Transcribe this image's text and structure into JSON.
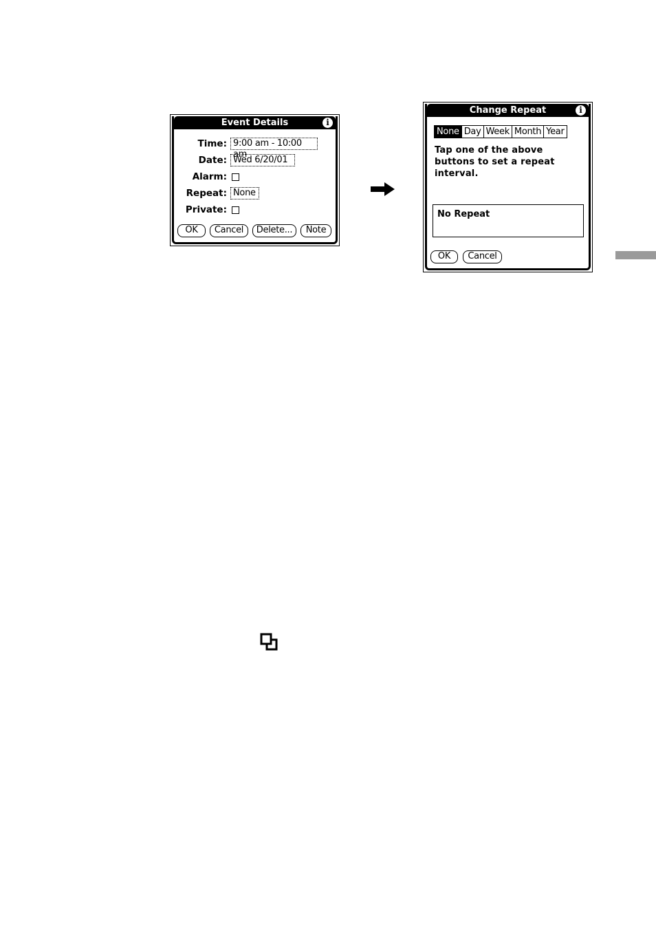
{
  "event_details": {
    "title": "Event Details",
    "info_icon": "info-icon",
    "fields": {
      "time_label": "Time:",
      "time_value": "9:00 am - 10:00 am",
      "date_label": "Date:",
      "date_value": "Wed 6/20/01",
      "alarm_label": "Alarm:",
      "alarm_checked": false,
      "repeat_label": "Repeat:",
      "repeat_value": "None",
      "private_label": "Private:",
      "private_checked": false
    },
    "buttons": {
      "ok": "OK",
      "cancel": "Cancel",
      "delete": "Delete...",
      "note": "Note"
    }
  },
  "arrow_icon": "right-arrow-icon",
  "change_repeat": {
    "title": "Change Repeat",
    "info_icon": "info-icon",
    "segments": [
      {
        "label": "None",
        "active": true
      },
      {
        "label": "Day",
        "active": false
      },
      {
        "label": "Week",
        "active": false
      },
      {
        "label": "Month",
        "active": false
      },
      {
        "label": "Year",
        "active": false
      }
    ],
    "instructions_line1": "Tap one of the above",
    "instructions_line2": "buttons to set a repeat",
    "instructions_line3": "interval.",
    "repeat_summary": "No Repeat",
    "buttons": {
      "ok": "OK",
      "cancel": "Cancel"
    }
  },
  "page_tab_marker": {
    "color": "#9a9a9a"
  },
  "inline_icon": "copy-icon"
}
